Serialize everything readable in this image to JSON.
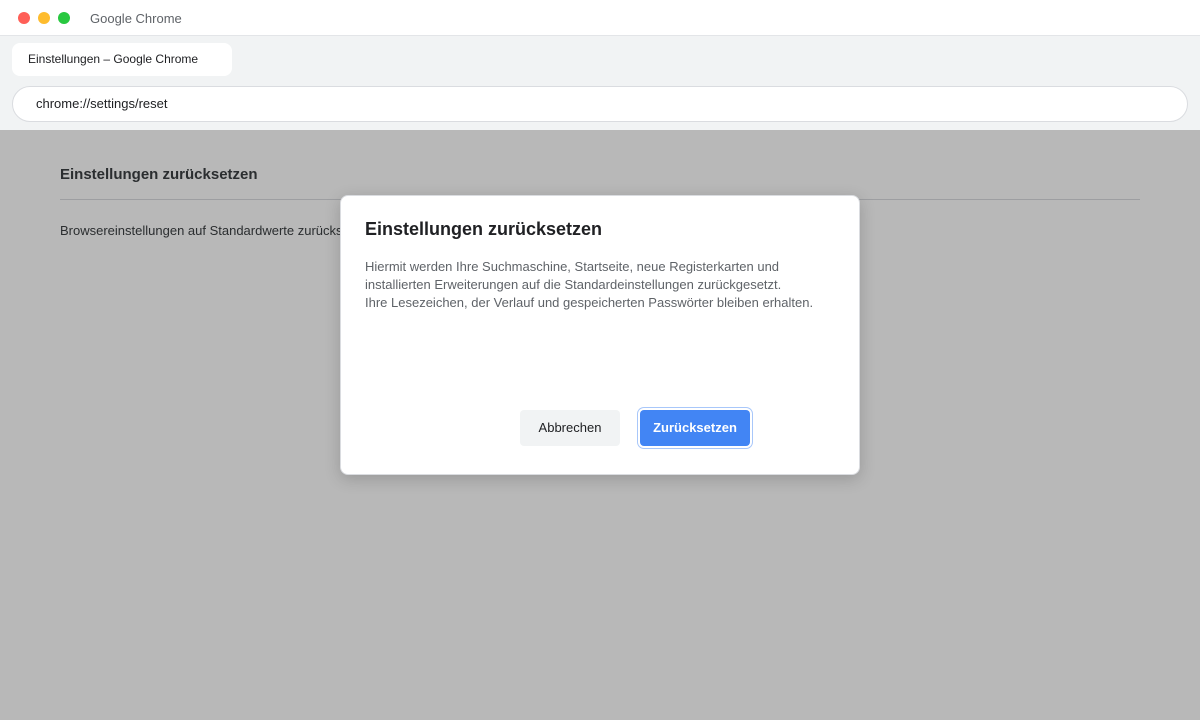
{
  "window": {
    "app_title": "Google Chrome"
  },
  "tabs": [
    {
      "label": "Einstellungen – Google Chrome"
    }
  ],
  "address_bar": {
    "url": "chrome://settings/reset"
  },
  "page": {
    "heading": "Einstellungen zurücksetzen",
    "row_label": "Browsereinstellungen auf Standardwerte zurücksetzen"
  },
  "dialog": {
    "title": "Einstellungen zurücksetzen",
    "body_lines": [
      "Hiermit werden Ihre Suchmaschine, Startseite, neue Registerkarten und",
      "installierten Erweiterungen auf die Standardeinstellungen zurückgesetzt.",
      "Ihre Lesezeichen, der Verlauf und gespeicherten Passwörter bleiben erhalten."
    ],
    "cancel_label": "Abbrechen",
    "confirm_label": "Zurücksetzen"
  },
  "colors": {
    "accent": "#4285f4",
    "close": "#ff5f57",
    "minimize": "#febc2e",
    "maximize": "#28c840"
  }
}
